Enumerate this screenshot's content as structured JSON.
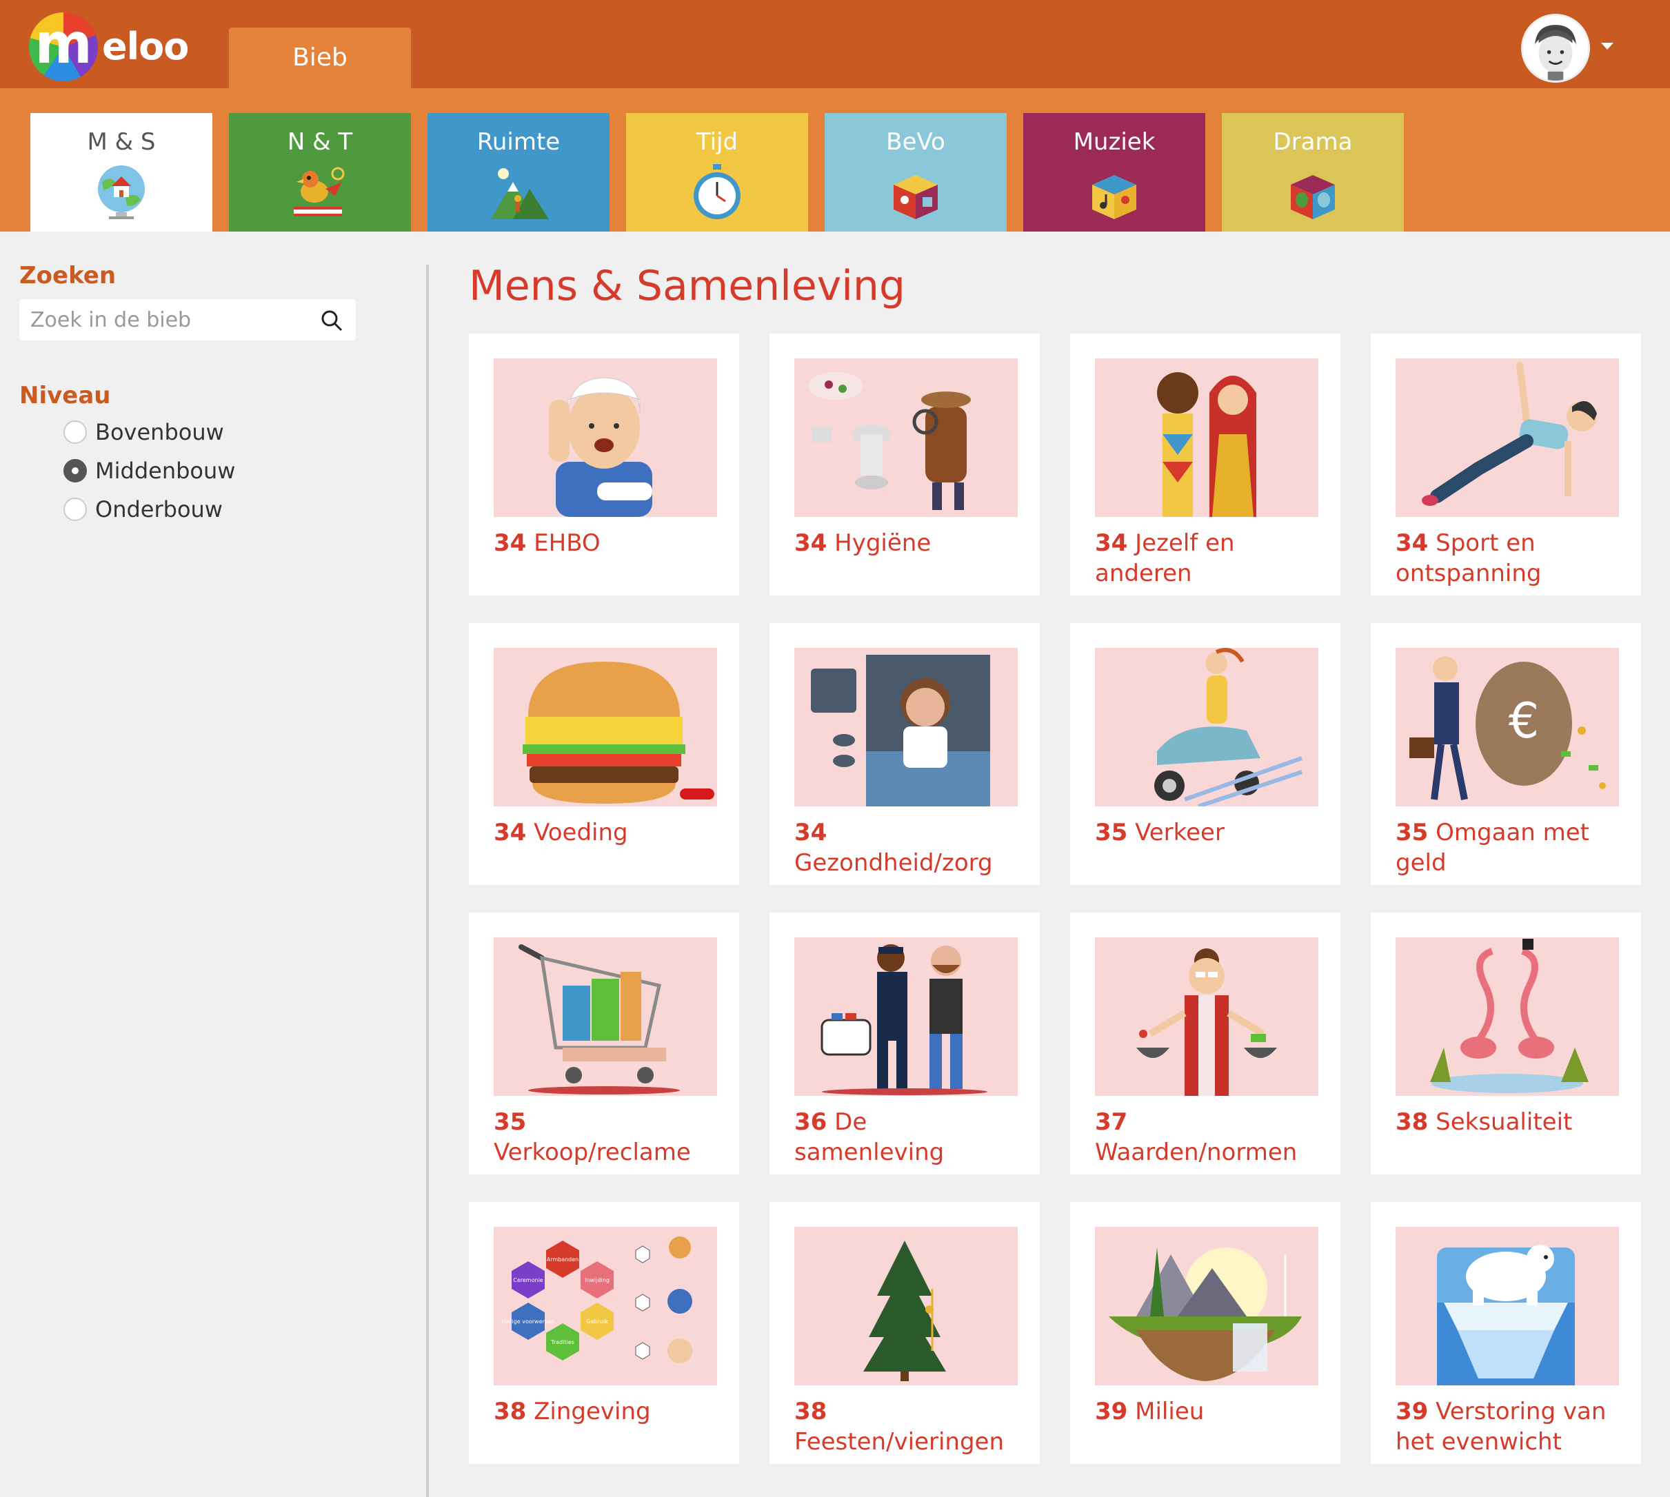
{
  "brand": {
    "logo_letter": "m",
    "logo_text": "eloo"
  },
  "header": {
    "tab": "Bieb"
  },
  "categories": [
    {
      "label": "M & S",
      "icon": "globe-house-icon",
      "color": "#ffffff",
      "active": true
    },
    {
      "label": "N & T",
      "icon": "bird-book-icon",
      "color": "#4f9a3e"
    },
    {
      "label": "Ruimte",
      "icon": "mountain-icon",
      "color": "#3f98c9"
    },
    {
      "label": "Tijd",
      "icon": "stopwatch-icon",
      "color": "#f2c744"
    },
    {
      "label": "BeVo",
      "icon": "art-cube-icon",
      "color": "#8ac7d8"
    },
    {
      "label": "Muziek",
      "icon": "music-cube-icon",
      "color": "#9c2a57"
    },
    {
      "label": "Drama",
      "icon": "masks-cube-icon",
      "color": "#dbc557"
    }
  ],
  "sidebar": {
    "search_heading": "Zoeken",
    "search_placeholder": "Zoek in de bieb",
    "level_heading": "Niveau",
    "levels": [
      {
        "label": "Bovenbouw",
        "checked": false
      },
      {
        "label": "Middenbouw",
        "checked": true
      },
      {
        "label": "Onderbouw",
        "checked": false
      }
    ]
  },
  "main": {
    "title": "Mens & Samenleving",
    "cards": [
      {
        "num": "34",
        "title": "EHBO",
        "icon": "injured-boy-icon"
      },
      {
        "num": "34",
        "title": "Hygiëne",
        "icon": "detective-toilet-icon"
      },
      {
        "num": "34",
        "title": "Jezelf en anderen",
        "icon": "two-women-icon"
      },
      {
        "num": "34",
        "title": "Sport en ontspanning",
        "icon": "yoga-girl-icon"
      },
      {
        "num": "34",
        "title": "Voeding",
        "icon": "burger-icon"
      },
      {
        "num": "34",
        "title": "Gezondheid/zorg",
        "icon": "sick-girl-bed-icon"
      },
      {
        "num": "35",
        "title": "Verkeer",
        "icon": "scooter-icon"
      },
      {
        "num": "35",
        "title": "Omgaan met geld",
        "icon": "money-bag-icon"
      },
      {
        "num": "35",
        "title": "Verkoop/reclame",
        "icon": "shopping-cart-icon"
      },
      {
        "num": "36",
        "title": "De samenleving",
        "icon": "police-arrest-icon"
      },
      {
        "num": "37",
        "title": "Waarden/normen",
        "icon": "scales-woman-icon"
      },
      {
        "num": "38",
        "title": "Seksualiteit",
        "icon": "flamingos-icon"
      },
      {
        "num": "38",
        "title": "Zingeving",
        "icon": "religion-hexagons-icon",
        "hex_labels": [
          "Armbanden",
          "Ceremonie",
          "Inwijding",
          "Heilige voorwerpen",
          "Tradities",
          "Gebruik"
        ]
      },
      {
        "num": "38",
        "title": "Feesten/vieringen",
        "icon": "christmas-tree-icon"
      },
      {
        "num": "39",
        "title": "Milieu",
        "icon": "floating-island-icon"
      },
      {
        "num": "39",
        "title": "Verstoring van het evenwicht",
        "icon": "polar-bear-icon"
      }
    ]
  }
}
